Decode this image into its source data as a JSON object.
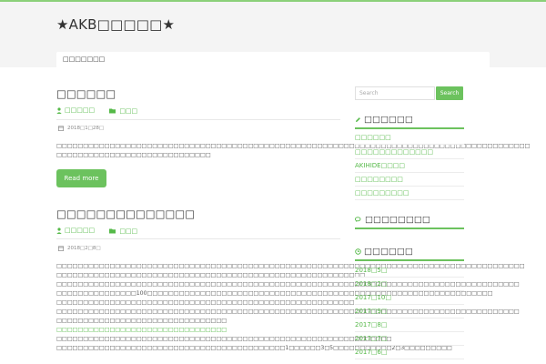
{
  "site": {
    "title": "★AKB□□□□□★"
  },
  "nav": {
    "items": [
      {
        "label": "□□□□□□□"
      }
    ]
  },
  "posts": [
    {
      "title": "□□□□□□",
      "author": "□□□□□",
      "category": "□□□",
      "date": "2018□1□28□",
      "excerpt": [
        "□□□□□□□□□□□□□□□□□□□□□□□□□□□□□□□□□□□□□□□□□□□□□□□□□□□□□□□□□□□□□□□□□□□□□□□□□□□□□□□□□□□□□□□□□",
        "□□□□□□□□□□□□□□□□□□□□□□□□□□□□□"
      ],
      "readmore": "Read more"
    },
    {
      "title": "□□□□□□□□□□□□□□",
      "author": "□□□□□",
      "category": "□□□",
      "date": "2018□2□8□",
      "excerpt": [
        "□□□□□□□□□□□□□□□□□□□□□□□□□□□□□□□□□□□□□□□□□□□□□□□□□□□□□□□□□□□□□□□□□□□□□□□□□□□□□□□□□□□□□□□□",
        "□□□□□□□□□□□□□□□□□□□□□□□□□□□□□□□□□□□□□□□□□□□□□□□□□□□□□□□□□□",
        "□□□□□□□□□□□□□□□□□□□□□□□□□□□□□□□□□□□□□□□□□□□□□□□□□□□□□□□□□□□□□□□□□□□□□□□□□□□□□□□□□□□□□□□",
        "□□□□□□□□□□□□□□□100□□□□□□□□□□□□□□□□□□□□□□□□□□□□□□□□□□□□□□□□□□□□□□□□□□□□□□□□□□□□□□□□□",
        "□□□□□□□□□□□□□□□□□□□□□□□□□□□□□□□□□□□□□□□□□□□□□□□□□□□□□□□□",
        "□□□□□□□□□□□□□□□□□□□□□□□□□□□□□□□□□□□□□□□□□□□□□□□□□□□□□□□□□□□□□□□□□□□□□□□□□□□□□□□□□□□□□□□",
        "□□□□□□□□□□□□□□□□□□□□□□□□□□□□□□□□"
      ],
      "excerpt_link": "□□□□□□□□□□□□□□□□□□□□□□□□□□□□□□□□",
      "excerpt_more": [
        "□□□□□□□□□□□□□□□□□□□□□□□□□□□□□□□□□□□□□□□□□□□□□□□□□□□□□□□□□□□□□□□",
        "□□□□□□□□□□□□□□□□□□□□□□□□□□□□□□□□□□□□□□□□□□□1□□□□□□3□5□□□□□□□□□□□2□3□□□□□□□□□"
      ]
    }
  ],
  "sidebar": {
    "search_placeholder": "Search",
    "search_button": "Search",
    "widgets": [
      {
        "title": "□□□□□□",
        "items": [
          "□□□□□□",
          "□□□□□□□□□□□□□",
          "AKIHIDE□□□□",
          "□□□□□□□□",
          "□□□□□□□□□"
        ]
      },
      {
        "title": "□□□□□□□□",
        "items": []
      },
      {
        "title": "□□□□□□",
        "items": [
          "2018□5□",
          "2018□2□",
          "2017□10□",
          "2017□9□",
          "2017□8□",
          "2017□7□",
          "2017□6□"
        ]
      }
    ]
  },
  "colors": {
    "accent": "#6cc25e",
    "link": "#55b948",
    "top_line": "#8bd079"
  }
}
